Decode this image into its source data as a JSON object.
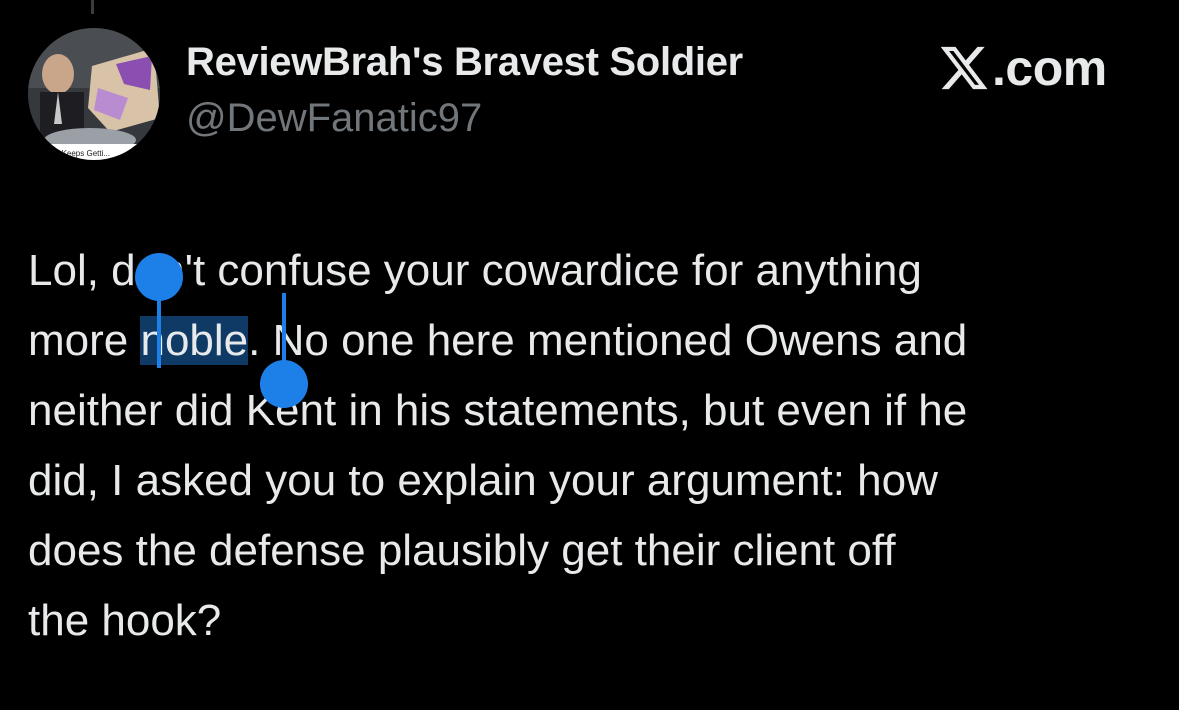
{
  "tweet": {
    "author": {
      "display_name": "ReviewBrah's Bravest Soldier",
      "handle": "@DewFanatic97",
      "avatar_caption": "...ing Keeps Getti..."
    },
    "brand": {
      "icon": "x-logo-icon",
      "text": ".com"
    },
    "lines": [
      {
        "before": "Lol, don't confuse your cowardice for anything",
        "selected": "",
        "after": ""
      },
      {
        "before": "more ",
        "selected": "noble",
        "after": ". No one here mentioned Owens and"
      },
      {
        "before": "neither did Kent in his statements, but even if he",
        "selected": "",
        "after": ""
      },
      {
        "before": "did, I asked you to explain your argument: how",
        "selected": "",
        "after": ""
      },
      {
        "before": "does the defense plausibly get their client off",
        "selected": "",
        "after": ""
      },
      {
        "before": "the hook?",
        "selected": "",
        "after": ""
      }
    ]
  },
  "selection": {
    "selected_text": "noble",
    "color": "#1d7fe8",
    "highlight_color": "#0f3a66"
  },
  "colors": {
    "background": "#000000",
    "primary_text": "#e7e9ea",
    "secondary_text": "#71767b"
  }
}
